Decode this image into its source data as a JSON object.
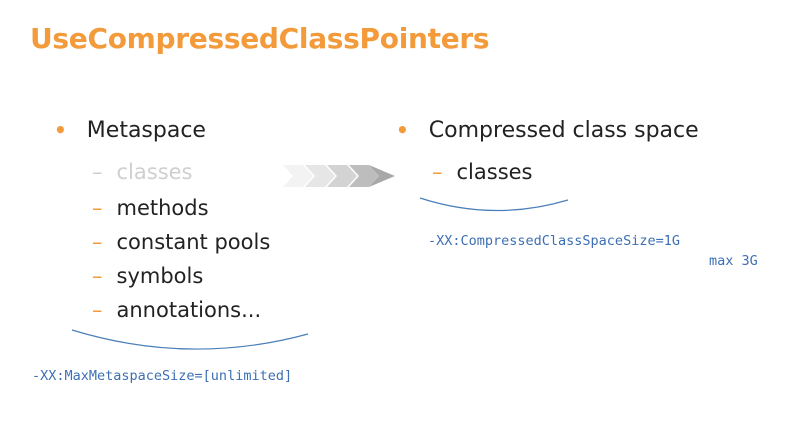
{
  "title": "UseCompressedClassPointers",
  "left": {
    "heading": "Metaspace",
    "items": [
      "classes",
      "methods",
      "constant pools",
      "symbols",
      "annotations..."
    ],
    "flag": "-XX:MaxMetaspaceSize=[unlimited]"
  },
  "right": {
    "heading": "Compressed class space",
    "items": [
      "classes"
    ],
    "flag_line1": "-XX:CompressedClassSpaceSize=1G",
    "flag_line2": "max 3G"
  },
  "colors": {
    "accent": "#f39a3a",
    "flag_text": "#3d6fb3",
    "brace": "#4a7fb8",
    "faded": "#cfcfcf"
  },
  "icons": [
    "bullet-icon",
    "chevron-arrow-icon",
    "brace-icon"
  ]
}
